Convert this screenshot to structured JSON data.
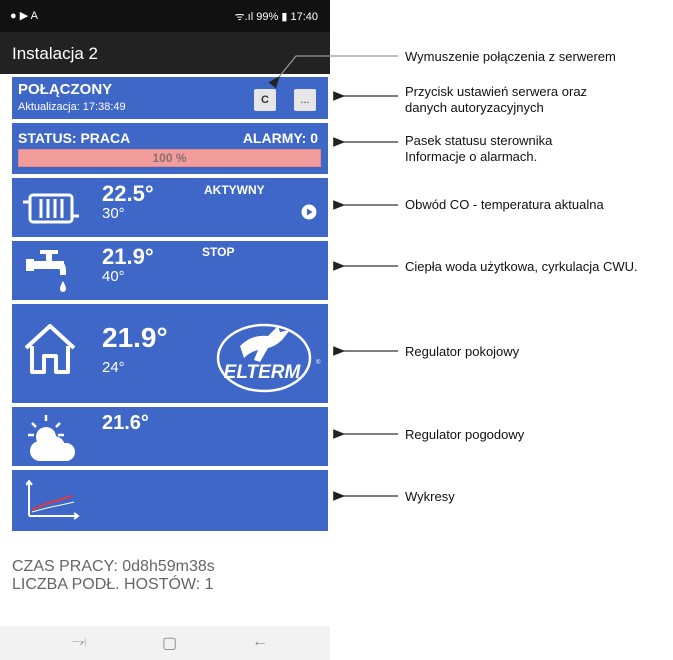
{
  "status_bar": {
    "time": "17:40",
    "battery": "99%",
    "left_icons": "● ▶ A",
    "signal": "ᯤ.ıl"
  },
  "app_bar": {
    "title": "Instalacja 2"
  },
  "connection_card": {
    "status": "POŁĄCZONY",
    "update": "Aktualizacja: 17:38:49",
    "btn_c": "C",
    "btn_more": "..."
  },
  "status_card": {
    "status": "STATUS: PRACA",
    "alarms": "ALARMY: 0",
    "progress_label": "100 %",
    "progress": 100
  },
  "circuits": [
    {
      "name": "co",
      "temp": "22.5°",
      "set": "30°",
      "state": "AKTYWNY",
      "icon": "radiator-icon"
    },
    {
      "name": "cwu",
      "temp": "21.9°",
      "set": "40°",
      "state": "STOP",
      "icon": "tap-icon"
    },
    {
      "name": "room",
      "temp": "21.9°",
      "set": "24°",
      "icon": "house-icon",
      "logo": "ELTERM"
    },
    {
      "name": "weather",
      "temp": "21.6°",
      "icon": "sun-cloud-icon"
    },
    {
      "name": "charts",
      "icon": "chart-icon"
    }
  ],
  "footer": {
    "uptime": "CZAS PRACY: 0d8h59m38s",
    "hosts": "LICZBA PODŁ. HOSTÓW: 1"
  },
  "annotations": {
    "force_connect": "Wymuszenie połączenia z serwerem",
    "server_settings_1": "Przycisk ustawień serwera oraz",
    "server_settings_2": "danych autoryzacyjnych",
    "status_1": "Pasek statusu sterownika",
    "status_2": "Informacje o alarmach.",
    "co": "Obwód CO - temperatura aktualna",
    "cwu": "Ciepła woda użytkowa, cyrkulacja CWU.",
    "room": "Regulator pokojowy",
    "weather": "Regulator pogodowy",
    "charts": "Wykresy"
  },
  "colors": {
    "card": "#3e67c7",
    "progress": "#f29c9c",
    "appbar": "#222222"
  },
  "nav": {
    "recent": "⥗",
    "home": "▢",
    "back": "←"
  }
}
